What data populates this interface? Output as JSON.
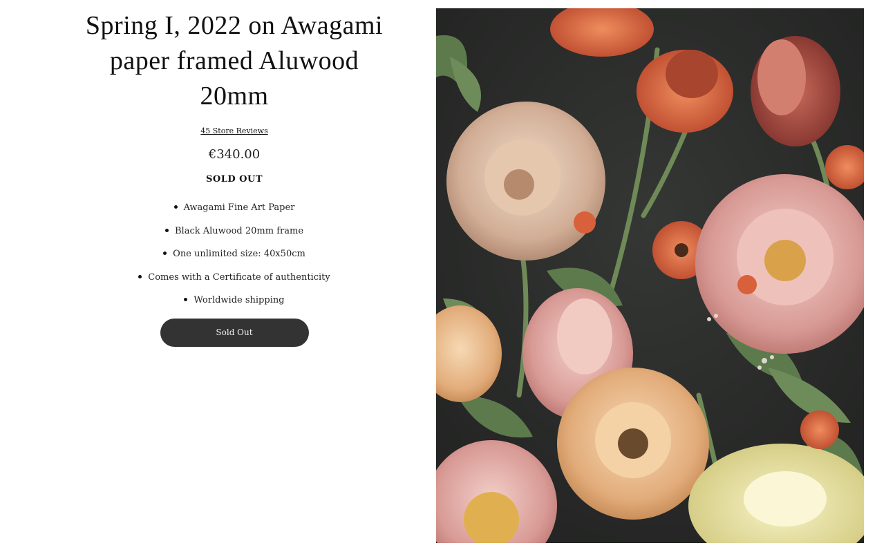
{
  "product": {
    "title": "Spring I, 2022 on Awagami paper framed Aluwood 20mm",
    "reviews_link": "45 Store Reviews",
    "price": "€340.00",
    "stock_status": "SOLD OUT",
    "features": [
      "Awagami Fine Art Paper",
      "Black Aluwood 20mm frame",
      "One unlimited size: 40x50cm",
      "Comes with a Certificate of authenticity",
      "Worldwide shipping"
    ],
    "button_label": "Sold Out"
  },
  "artwork": {
    "subject": "floral still life: tulips, peonies and poppies on a dark background",
    "colors": {
      "background": "#2a2c2a",
      "pink": "#e0a9a4",
      "peach": "#e8b98a",
      "orange": "#d8603a",
      "yellow": "#e9e3a3",
      "leaf": "#5d7a4c"
    }
  }
}
